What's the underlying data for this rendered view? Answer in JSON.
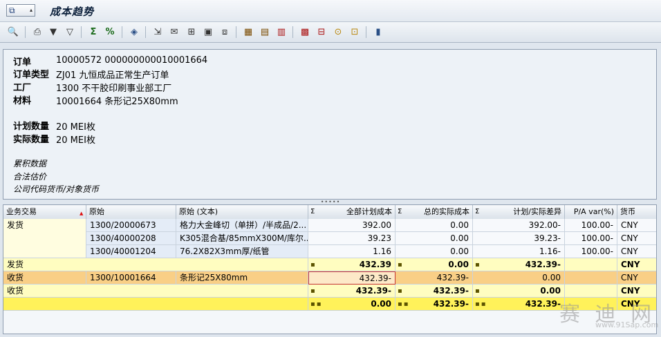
{
  "window": {
    "title": "成本趋势"
  },
  "toolbar": {
    "buttons": [
      "details-icon",
      "print-icon",
      "set-filter-icon",
      "filter-icon",
      "sum-icon",
      "subtotal-icon",
      "display-variant-icon",
      "export-icon",
      "send-icon",
      "graphic-icon",
      "abc-analysis-icon",
      "layout-icon",
      "change-layout-icon",
      "save-layout-icon",
      "hierarchy-icon",
      "cost-components-icon",
      "currency-icon",
      "settings-icon",
      "report-icon"
    ]
  },
  "header": {
    "order_label": "订单",
    "order_value": "10000572 000000000010001664",
    "order_type_label": "订单类型",
    "order_type_value": "ZJ01 九恒成品正常生产订单",
    "plant_label": "工厂",
    "plant_value": "1300 不干胶印刷事业部工厂",
    "material_label": "材料",
    "material_value": "10001664 条形记25X80mm",
    "planned_qty_label": "计划数量",
    "planned_qty_value": "20 MEI枚",
    "actual_qty_label": "实际数量",
    "actual_qty_value": "20 MEI枚",
    "cumulative": "累积数据",
    "legal_valuation": "合法估价",
    "currency_mode": "公司代码货币/对象货币"
  },
  "grid": {
    "columns": {
      "business_txn": "业务交易",
      "origin": "原始",
      "origin_text": "原始 (文本)",
      "total_plan": "全部计划成本",
      "total_actual": "总的实际成本",
      "variance": "计划/实际差异",
      "pa_var": "P/A var(%)",
      "currency": "货币"
    },
    "rows": [
      {
        "txn": "发货",
        "origin": "1300/20000673",
        "text": "格力大金峰切（单拼）/半成品/2...",
        "plan": "392.00",
        "actual": "0.00",
        "variance": "392.00-",
        "pa": "100.00-",
        "cur": "CNY"
      },
      {
        "txn": "",
        "origin": "1300/40000208",
        "text": "K305混合基/85mmX300M/库尔...",
        "plan": "39.23",
        "actual": "0.00",
        "variance": "39.23-",
        "pa": "100.00-",
        "cur": "CNY"
      },
      {
        "txn": "",
        "origin": "1300/40001204",
        "text": "76.2X82X3mm厚/纸管",
        "plan": "1.16",
        "actual": "0.00",
        "variance": "1.16-",
        "pa": "100.00-",
        "cur": "CNY"
      }
    ],
    "subtotal_issue": {
      "txn": "发货",
      "plan": "432.39",
      "actual": "0.00",
      "variance": "432.39-",
      "cur": "CNY"
    },
    "receipt_row": {
      "txn": "收货",
      "origin": "1300/10001664",
      "text": "条形记25X80mm",
      "plan": "432.39-",
      "actual": "432.39-",
      "variance": "0.00",
      "cur": "CNY"
    },
    "subtotal_receipt": {
      "txn": "收货",
      "plan": "432.39-",
      "actual": "432.39-",
      "variance": "0.00",
      "cur": "CNY"
    },
    "grand_total": {
      "plan": "0.00",
      "actual": "432.39-",
      "variance": "432.39-",
      "cur": "CNY"
    },
    "sigma": "Σ"
  },
  "watermark": {
    "main": "赛 迪 网",
    "url": "www.91Sap.com"
  }
}
